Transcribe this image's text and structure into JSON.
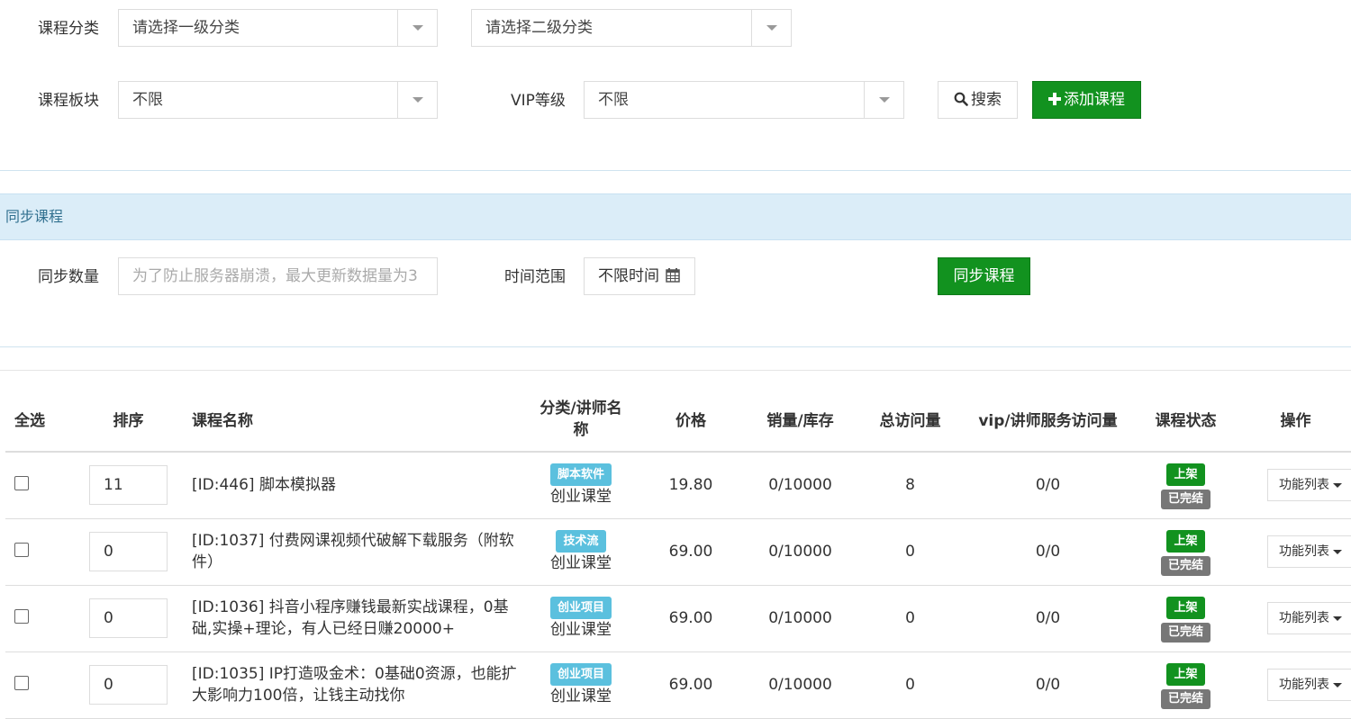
{
  "filters": {
    "category_label": "课程分类",
    "level1_placeholder": "请选择一级分类",
    "level2_placeholder": "请选择二级分类",
    "block_label": "课程板块",
    "block_value": "不限",
    "vip_label": "VIP等级",
    "vip_value": "不限",
    "search_label": "搜索",
    "add_label": "添加课程"
  },
  "sync": {
    "panel_title": "同步课程",
    "count_label": "同步数量",
    "count_placeholder": "为了防止服务器崩溃，最大更新数据量为3",
    "time_label": "时间范围",
    "time_value": "不限时间",
    "sync_button": "同步课程"
  },
  "table": {
    "headers": {
      "select_all": "全选",
      "sort": "排序",
      "name": "课程名称",
      "category_line1": "分类/讲师名",
      "category_line2": "称",
      "price": "价格",
      "sales": "销量/库存",
      "visits": "总访问量",
      "vip_visits": "vip/讲师服务访问量",
      "status": "课程状态",
      "ops": "操作"
    },
    "rows": [
      {
        "sort": "11",
        "name": "[ID:446] 脚本模拟器",
        "tag": "脚本软件",
        "teacher": "创业课堂",
        "price": "19.80",
        "sales": "0/10000",
        "visits": "8",
        "vip": "0/0",
        "status_on": "上架",
        "status_done": "已完结",
        "ops": "功能列表"
      },
      {
        "sort": "0",
        "name": "[ID:1037] 付费网课视频代破解下载服务（附软件）",
        "tag": "技术流",
        "teacher": "创业课堂",
        "price": "69.00",
        "sales": "0/10000",
        "visits": "0",
        "vip": "0/0",
        "status_on": "上架",
        "status_done": "已完结",
        "ops": "功能列表"
      },
      {
        "sort": "0",
        "name": "[ID:1036] 抖音小程序赚钱最新实战课程，0基础,实操+理论，有人已经日赚20000+",
        "tag": "创业项目",
        "teacher": "创业课堂",
        "price": "69.00",
        "sales": "0/10000",
        "visits": "0",
        "vip": "0/0",
        "status_on": "上架",
        "status_done": "已完结",
        "ops": "功能列表"
      },
      {
        "sort": "0",
        "name": "[ID:1035] IP打造吸金术：0基础0资源，也能扩大影响力100倍，让钱主动找你",
        "tag": "创业项目",
        "teacher": "创业课堂",
        "price": "69.00",
        "sales": "0/10000",
        "visits": "0",
        "vip": "0/0",
        "status_on": "上架",
        "status_done": "已完结",
        "ops": "功能列表"
      }
    ]
  }
}
